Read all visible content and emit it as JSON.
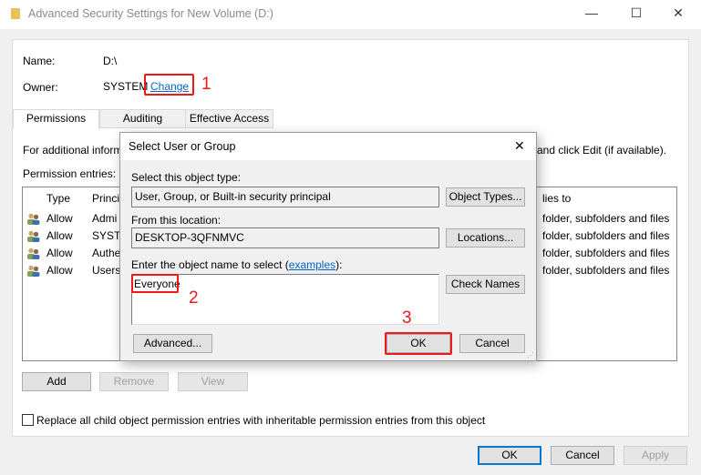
{
  "window": {
    "title": "Advanced Security Settings for New Volume (D:)",
    "minimize": "—",
    "maximize": "☐",
    "close": "✕"
  },
  "info": {
    "name_label": "Name:",
    "name_value": "D:\\",
    "owner_label": "Owner:",
    "owner_value": "SYSTEM",
    "change_link": "Change"
  },
  "annotations": [
    "1",
    "2",
    "3"
  ],
  "tabs": [
    {
      "label": "Permissions",
      "active": true
    },
    {
      "label": "Auditing"
    },
    {
      "label": "Effective Access"
    }
  ],
  "description_start": "For additional inform",
  "description_end": "and click Edit (if available).",
  "permission_entries_label": "Permission entries:",
  "list": {
    "headers": {
      "type": "Type",
      "principal": "Princi",
      "applies": "lies to"
    },
    "rows": [
      {
        "type": "Allow",
        "principal": "Admi",
        "applies": "folder, subfolders and files"
      },
      {
        "type": "Allow",
        "principal": "SYSTE",
        "applies": "folder, subfolders and files"
      },
      {
        "type": "Allow",
        "principal": "Authe",
        "applies": "folder, subfolders and files"
      },
      {
        "type": "Allow",
        "principal": "Users",
        "applies": "folder, subfolders and files"
      }
    ]
  },
  "buttons": {
    "add": "Add",
    "remove": "Remove",
    "view": "View",
    "ok": "OK",
    "cancel": "Cancel",
    "apply": "Apply"
  },
  "replace_checkbox": {
    "label": "Replace all child object permission entries with inheritable permission entries from this object",
    "checked": false
  },
  "dialog": {
    "title": "Select User or Group",
    "close": "✕",
    "object_type_label": "Select this object type:",
    "object_type_value": "User, Group, or Built-in security principal",
    "object_types_button": "Object Types...",
    "location_label": "From this location:",
    "location_value": "DESKTOP-3QFNMVC",
    "locations_button": "Locations...",
    "object_name_label_pre": "Enter the object name to select (",
    "examples_link": "examples",
    "object_name_label_post": "):",
    "object_name_value": "Everyone",
    "check_names_button": "Check Names",
    "advanced_button": "Advanced...",
    "ok_button": "OK",
    "cancel_button": "Cancel"
  }
}
